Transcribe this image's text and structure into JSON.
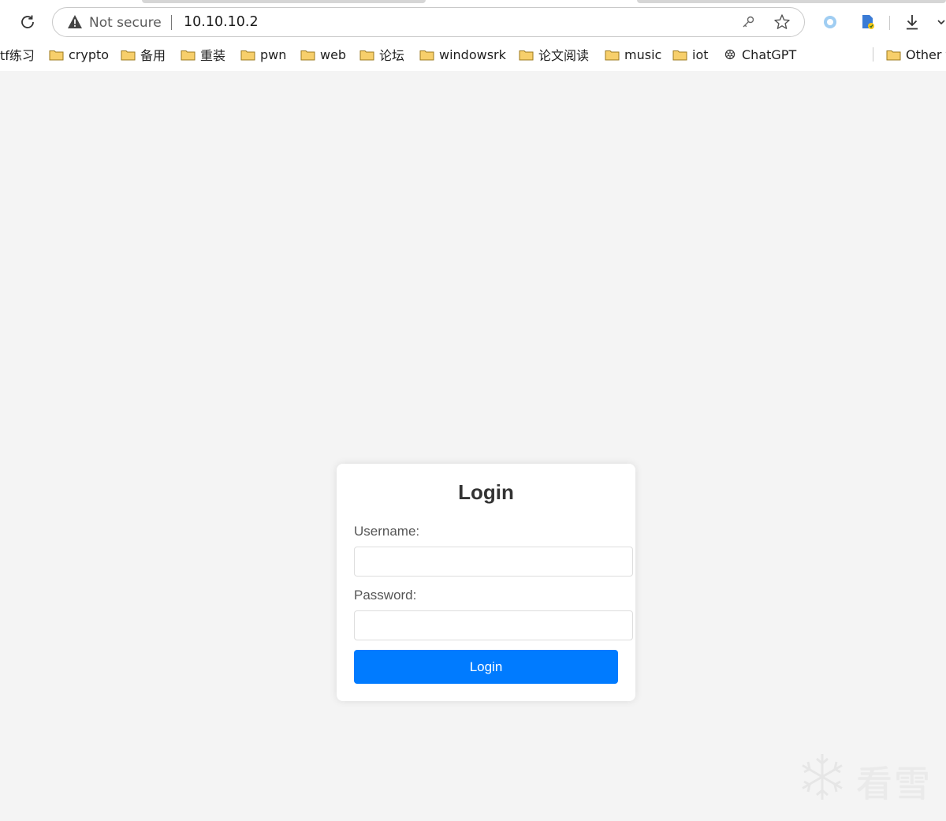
{
  "browser": {
    "address_bar": {
      "security_label": "Not secure",
      "url": "10.10.10.2"
    },
    "bookmarks": [
      {
        "label": "tf练习",
        "icon": "none"
      },
      {
        "label": "crypto",
        "icon": "folder-icon"
      },
      {
        "label": "备用",
        "icon": "folder-icon"
      },
      {
        "label": "重装",
        "icon": "folder-icon"
      },
      {
        "label": "pwn",
        "icon": "folder-icon"
      },
      {
        "label": "web",
        "icon": "folder-icon"
      },
      {
        "label": "论坛",
        "icon": "folder-icon"
      },
      {
        "label": "windowsrk",
        "icon": "folder-icon"
      },
      {
        "label": "论文阅读",
        "icon": "folder-icon"
      },
      {
        "label": "music",
        "icon": "folder-icon"
      },
      {
        "label": "iot",
        "icon": "folder-icon"
      },
      {
        "label": "ChatGPT",
        "icon": "openai-icon"
      }
    ],
    "other_bookmarks_label": "Other f"
  },
  "login": {
    "title": "Login",
    "username_label": "Username:",
    "username_value": "",
    "password_label": "Password:",
    "password_value": "",
    "submit_label": "Login"
  },
  "watermark": {
    "text": "看雪"
  },
  "colors": {
    "page_background": "#f4f4f4",
    "button_primary": "#007bff",
    "folder_fill": "#f7cf6b",
    "folder_stroke": "#9c7a1e"
  }
}
